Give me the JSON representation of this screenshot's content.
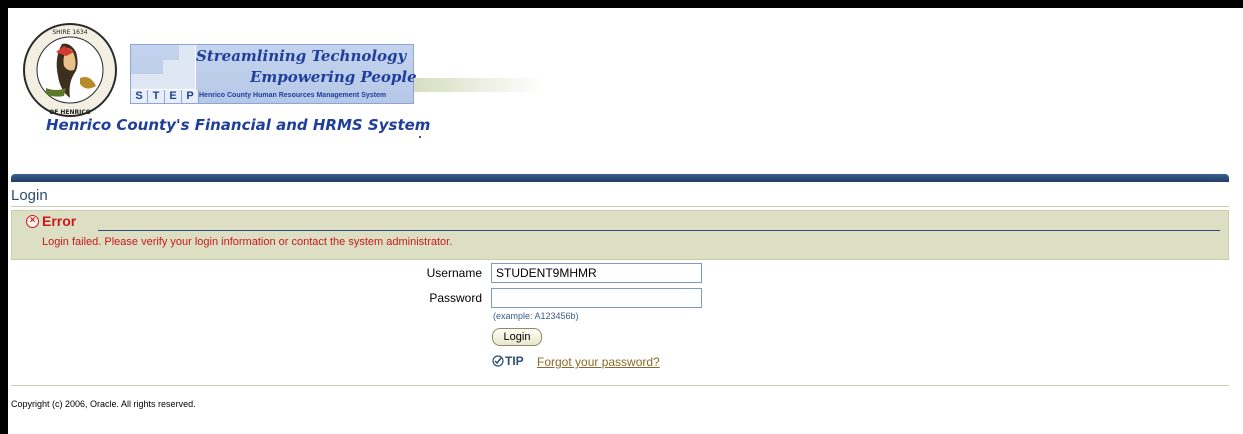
{
  "header": {
    "slogan_line1": "Streamlining Technology",
    "slogan_line2": "Empowering People",
    "step_letters": [
      "S",
      "T",
      "E",
      "P"
    ],
    "step_subtitle": "Henrico County Human Resources Management System",
    "org_title": "Henrico County's Financial and HRMS System",
    "seal_icon": "county-seal-icon"
  },
  "page": {
    "heading": "Login"
  },
  "error": {
    "title": "Error",
    "message": "Login failed. Please verify your login information or contact the system administrator.",
    "color": "#c81a1a"
  },
  "form": {
    "username_label": "Username",
    "username_value": "STUDENT9MHMR",
    "password_label": "Password",
    "password_value": "",
    "password_hint": "(example: A123456b)",
    "login_button": "Login",
    "tip_label": "TIP",
    "forgot_link": "Forgot your password?"
  },
  "footer": {
    "copyright": "Copyright (c) 2006, Oracle. All rights reserved."
  },
  "colors": {
    "brand_blue": "#1f3f9a",
    "rule_blue": "#2d4f6f",
    "error_bg": "#dddfc5"
  }
}
